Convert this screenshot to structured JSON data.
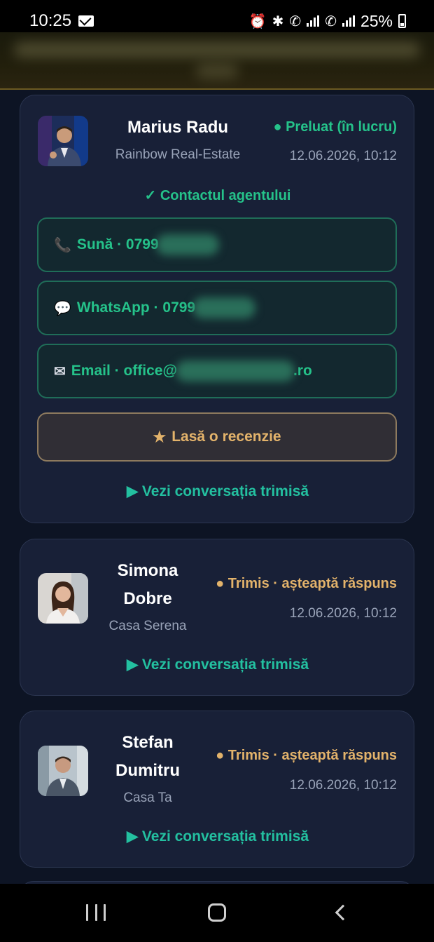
{
  "status_bar": {
    "time": "10:25",
    "battery": "25%",
    "icons": [
      "mail-icon",
      "alarm-icon",
      "bluetooth-icon",
      "volte-icon",
      "4g-icon",
      "signal-icon",
      "battery-icon"
    ]
  },
  "colors": {
    "background": "#0d1424",
    "card": "#182037",
    "accepted": "#25c28a",
    "pending": "#e3b36b",
    "link": "#23c0a0"
  },
  "agents": [
    {
      "name": "Marius Radu",
      "agency": "Rainbow Real-Estate",
      "status": "● Preluat (în lucru)",
      "datetime": "12.06.2026, 10:12",
      "contact_heading": "✓ Contactul agentului",
      "contacts": [
        {
          "icon": "phone-icon",
          "label": "Sună · 0799"
        },
        {
          "icon": "chat-icon",
          "label": "WhatsApp · 0799"
        },
        {
          "icon": "envelope-icon",
          "label": "Email · office@",
          "suffix": ".ro"
        }
      ],
      "review_label": "Lasă o recenzie",
      "conversation_link": "▶ Vezi conversația trimisă"
    },
    {
      "name_line1": "Simona",
      "name_line2": "Dobre",
      "agency": "Casa Serena",
      "status": "● Trimis · așteaptă răspuns",
      "datetime": "12.06.2026, 10:12",
      "conversation_link": "▶ Vezi conversația trimisă"
    },
    {
      "name_line1": "Stefan",
      "name_line2": "Dumitru",
      "agency": "Casa Ta",
      "status": "● Trimis · așteaptă răspuns",
      "datetime": "12.06.2026, 10:12",
      "conversation_link": "▶ Vezi conversația trimisă"
    }
  ],
  "nav": {
    "icons": [
      "recent-apps-icon",
      "home-icon",
      "back-icon"
    ]
  }
}
